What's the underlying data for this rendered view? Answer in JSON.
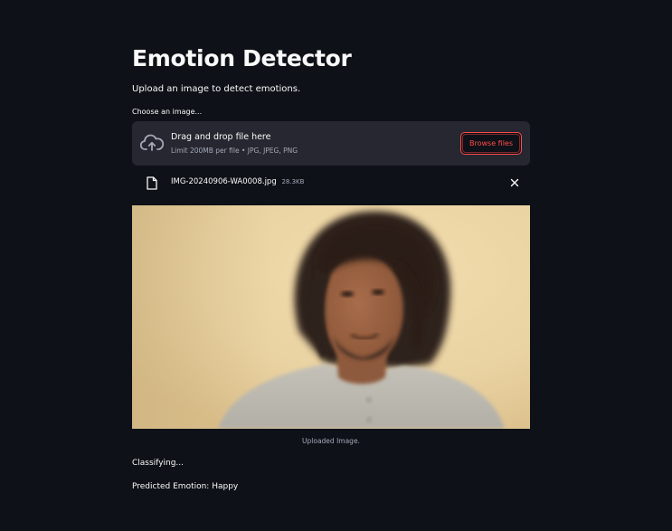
{
  "app": {
    "title": "Emotion Detector",
    "subtitle": "Upload an image to detect emotions."
  },
  "uploader": {
    "label": "Choose an image...",
    "dropzone_text": "Drag and drop file here",
    "limit_text": "Limit 200MB per file • JPG, JPEG, PNG",
    "browse_label": "Browse files",
    "upload_icon": "cloud-upload-icon"
  },
  "uploaded_file": {
    "name": "IMG-20240906-WA0008.jpg",
    "size": "28.3KB",
    "file_icon": "file-icon",
    "remove_icon": "close-icon"
  },
  "image": {
    "caption": "Uploaded Image."
  },
  "status": {
    "classifying": "Classifying...",
    "prediction": "Predicted Emotion: Happy"
  },
  "colors": {
    "background": "#0e1117",
    "dropzone": "#262730",
    "accent": "#ff4b4b",
    "text": "#fafafa",
    "muted_text": "#a3a8b8"
  }
}
